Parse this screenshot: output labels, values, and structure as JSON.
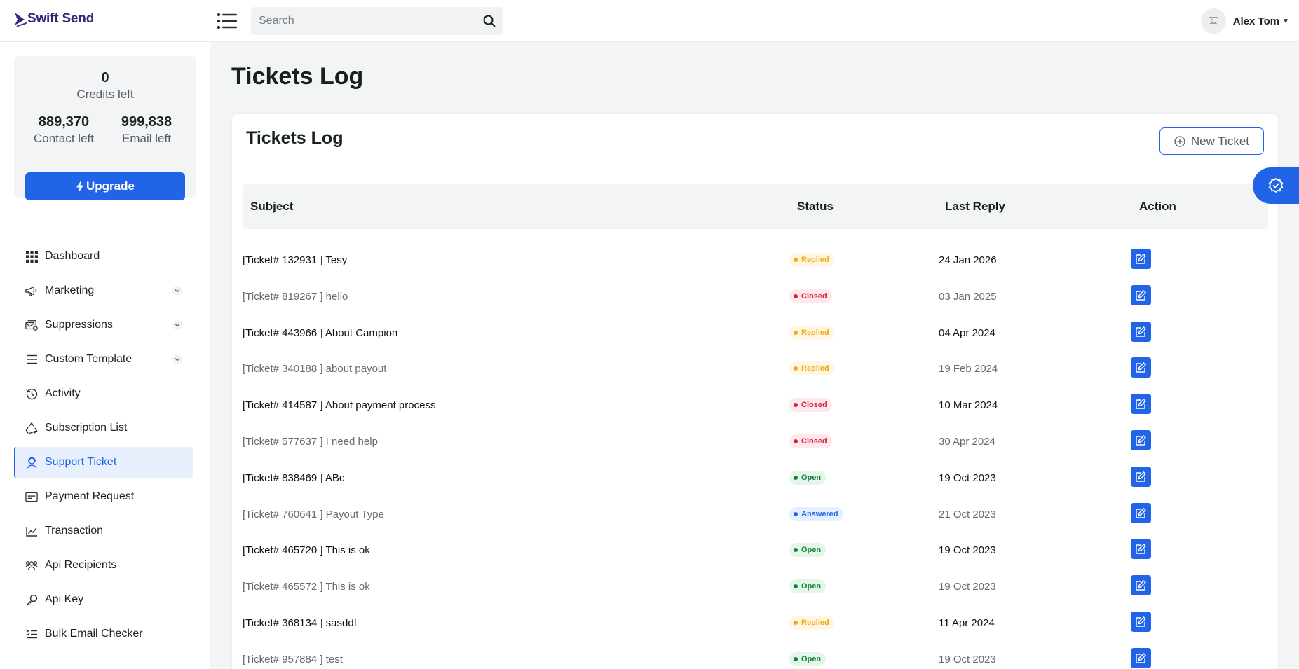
{
  "app": {
    "logo_text": "Swift Send"
  },
  "header": {
    "search_placeholder": "Search",
    "user_name": "Alex Tom"
  },
  "credits": {
    "credits_value": "0",
    "credits_label": "Credits left",
    "contact_value": "889,370",
    "contact_label": "Contact left",
    "email_value": "999,838",
    "email_label": "Email left",
    "upgrade_label": "Upgrade"
  },
  "nav": {
    "items": [
      {
        "label": "Dashboard",
        "icon": "grid-icon"
      },
      {
        "label": "Marketing",
        "icon": "megaphone-icon"
      },
      {
        "label": "Suppressions",
        "icon": "mail-stack-icon"
      },
      {
        "label": "Custom Template",
        "icon": "list-icon"
      },
      {
        "label": "Activity",
        "icon": "history-icon"
      },
      {
        "label": "Subscription List",
        "icon": "recycle-icon"
      },
      {
        "label": "Support Ticket",
        "icon": "support-user-icon"
      },
      {
        "label": "Payment Request",
        "icon": "payment-card-icon"
      },
      {
        "label": "Transaction",
        "icon": "line-chart-icon"
      },
      {
        "label": "Api Recipients",
        "icon": "users-icon"
      },
      {
        "label": "Api Key",
        "icon": "key-icon"
      },
      {
        "label": "Bulk Email Checker",
        "icon": "checklist-icon"
      }
    ]
  },
  "page": {
    "title": "Tickets Log"
  },
  "card": {
    "title": "Tickets Log",
    "new_ticket_label": "New Ticket",
    "columns": {
      "subject": "Subject",
      "status": "Status",
      "last_reply": "Last Reply",
      "action": "Action"
    }
  },
  "tickets": [
    {
      "subject": "[Ticket# 132931 ] Tesy",
      "status": "Replied",
      "last_reply": "24 Jan 2026"
    },
    {
      "subject": "[Ticket# 819267 ] hello",
      "status": "Closed",
      "last_reply": "03 Jan 2025"
    },
    {
      "subject": "[Ticket# 443966 ] About Campion",
      "status": "Replied",
      "last_reply": "04 Apr 2024"
    },
    {
      "subject": "[Ticket# 340188 ] about payout",
      "status": "Replied",
      "last_reply": "19 Feb 2024"
    },
    {
      "subject": "[Ticket# 414587 ] About payment process",
      "status": "Closed",
      "last_reply": "10 Mar 2024"
    },
    {
      "subject": "[Ticket# 577637 ] I need help",
      "status": "Closed",
      "last_reply": "30 Apr 2024"
    },
    {
      "subject": "[Ticket# 838469 ] ABc",
      "status": "Open",
      "last_reply": "19 Oct 2023"
    },
    {
      "subject": "[Ticket# 760641 ] Payout Type",
      "status": "Answered",
      "last_reply": "21 Oct 2023"
    },
    {
      "subject": "[Ticket# 465720 ] This is ok",
      "status": "Open",
      "last_reply": "19 Oct 2023"
    },
    {
      "subject": "[Ticket# 465572 ] This is ok",
      "status": "Open",
      "last_reply": "19 Oct 2023"
    },
    {
      "subject": "[Ticket# 368134 ] sasddf",
      "status": "Replied",
      "last_reply": "11 Apr 2024"
    },
    {
      "subject": "[Ticket# 957884 ] test",
      "status": "Open",
      "last_reply": "19 Oct 2023"
    }
  ],
  "colors": {
    "primary": "#2164e8",
    "replied": "#f2a814",
    "closed": "#d61f3c",
    "open": "#12813b",
    "answered": "#2164e8"
  }
}
